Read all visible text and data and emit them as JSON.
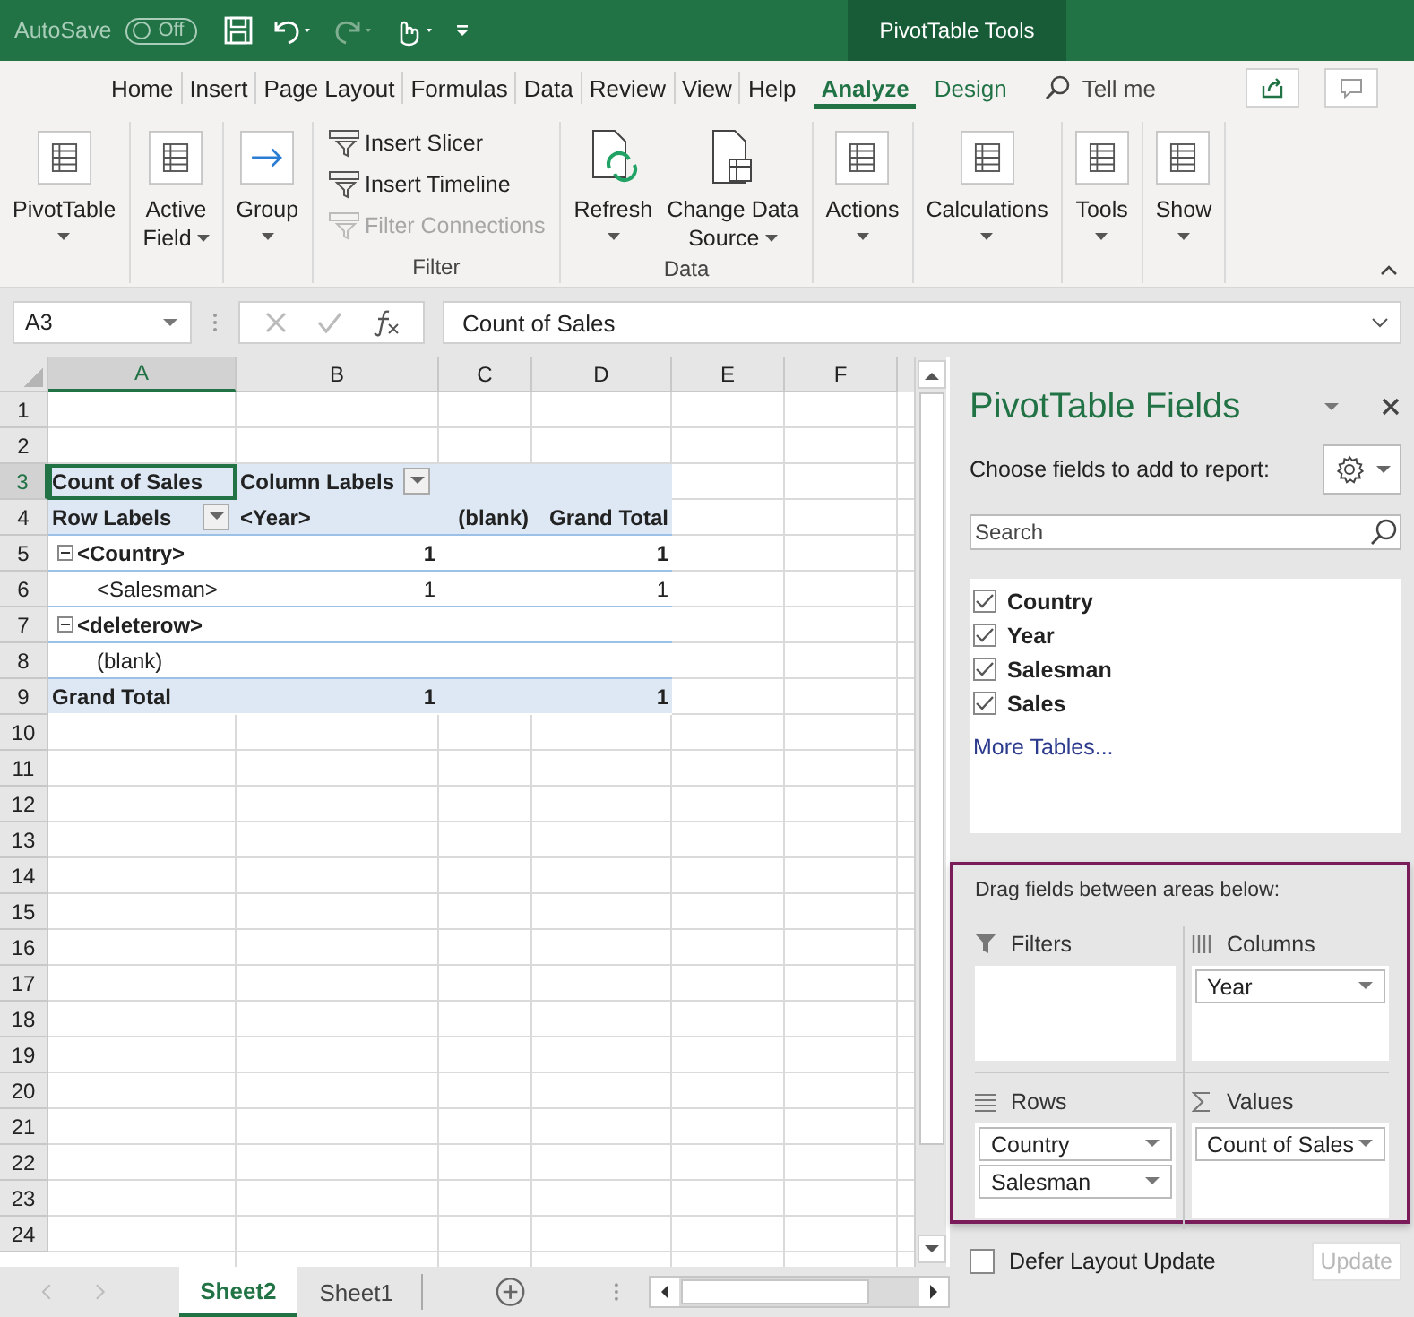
{
  "title_bar": {
    "autosave_label": "AutoSave",
    "autosave": {
      "on": false,
      "label": "Off"
    },
    "context_label": "PivotTable Tools"
  },
  "ribbon": {
    "tabs": [
      {
        "label": "Home",
        "selected": false,
        "contextual": false
      },
      {
        "label": "Insert",
        "selected": false,
        "contextual": false
      },
      {
        "label": "Page Layout",
        "selected": false,
        "contextual": false
      },
      {
        "label": "Formulas",
        "selected": false,
        "contextual": false
      },
      {
        "label": "Data",
        "selected": false,
        "contextual": false
      },
      {
        "label": "Review",
        "selected": false,
        "contextual": false
      },
      {
        "label": "View",
        "selected": false,
        "contextual": false
      },
      {
        "label": "Help",
        "selected": false,
        "contextual": false
      },
      {
        "label": "Analyze",
        "selected": true,
        "contextual": true
      },
      {
        "label": "Design",
        "selected": false,
        "contextual": true
      }
    ],
    "tell_me": "Tell me",
    "groups": [
      {
        "buttons": [
          {
            "kind": "large",
            "label": [
              "PivotTable"
            ],
            "dropdown": true
          }
        ]
      },
      {
        "buttons": [
          {
            "kind": "large",
            "label": [
              "Active",
              "Field"
            ],
            "dropdown": true
          }
        ]
      },
      {
        "buttons": [
          {
            "kind": "large",
            "label": [
              "Group"
            ],
            "dropdown": true
          }
        ]
      },
      {
        "label": "Filter",
        "buttons": [
          {
            "kind": "small",
            "label": [
              "Insert Slicer"
            ],
            "disabled": false
          },
          {
            "kind": "small",
            "label": [
              "Insert Timeline"
            ],
            "disabled": false
          },
          {
            "kind": "small",
            "label": [
              "Filter Connections"
            ],
            "disabled": true
          }
        ]
      },
      {
        "label": "Data",
        "buttons": [
          {
            "kind": "large",
            "label": [
              "Refresh"
            ],
            "dropdown": true
          },
          {
            "kind": "large",
            "label": [
              "Change Data",
              "Source"
            ],
            "dropdown": true
          }
        ]
      },
      {
        "buttons": [
          {
            "kind": "large",
            "label": [
              "Actions"
            ],
            "dropdown": true
          }
        ]
      },
      {
        "buttons": [
          {
            "kind": "large",
            "label": [
              "Calculations"
            ],
            "dropdown": true
          }
        ]
      },
      {
        "buttons": [
          {
            "kind": "large",
            "label": [
              "Tools"
            ],
            "dropdown": true
          }
        ]
      },
      {
        "buttons": [
          {
            "kind": "large",
            "label": [
              "Show"
            ],
            "dropdown": true
          }
        ]
      }
    ]
  },
  "formula_bar": {
    "name_box": "A3",
    "formula": "Count of Sales"
  },
  "sheet": {
    "columns": [
      {
        "label": "A",
        "selected": true
      },
      {
        "label": "B",
        "selected": false
      },
      {
        "label": "C",
        "selected": false
      },
      {
        "label": "D",
        "selected": false
      },
      {
        "label": "E",
        "selected": false
      },
      {
        "label": "F",
        "selected": false
      }
    ],
    "rows": [
      {
        "number": "1",
        "selected": false,
        "kind": "empty"
      },
      {
        "number": "2",
        "selected": false,
        "kind": "empty"
      },
      {
        "number": "3",
        "selected": true,
        "kind": "header",
        "cells": [
          {
            "text": "Count of Sales"
          },
          {
            "text": "Column Labels",
            "filter_button": true
          }
        ]
      },
      {
        "number": "4",
        "selected": false,
        "kind": "header-last",
        "cells": [
          {
            "text": "Row Labels",
            "filter_button": true
          },
          {
            "text": "<Year>"
          },
          {
            "text": "(blank)",
            "right_aligned": true
          },
          {
            "text": "Grand Total",
            "right_aligned": true
          }
        ]
      },
      {
        "number": "5",
        "selected": false,
        "kind": "group",
        "cells": [
          {
            "text": "<Country>",
            "expanded": true
          },
          {
            "text": "1",
            "right_aligned": true
          },
          {},
          {
            "text": "1",
            "right_aligned": true
          }
        ]
      },
      {
        "number": "6",
        "selected": false,
        "kind": "detail",
        "cells": [
          {
            "text": "<Salesman>"
          },
          {
            "text": "1",
            "right_aligned": true
          },
          {},
          {
            "text": "1",
            "right_aligned": true
          }
        ]
      },
      {
        "number": "7",
        "selected": false,
        "kind": "group",
        "cells": [
          {
            "text": "<deleterow>",
            "expanded": true
          }
        ]
      },
      {
        "number": "8",
        "selected": false,
        "kind": "detail",
        "cells": [
          {
            "text": "(blank)"
          }
        ]
      },
      {
        "number": "9",
        "selected": false,
        "kind": "total",
        "cells": [
          {
            "text": "Grand Total"
          },
          {
            "text": "1",
            "right_aligned": true
          },
          {},
          {
            "text": "1",
            "right_aligned": true
          }
        ]
      },
      {
        "number": "10",
        "selected": false,
        "kind": "empty"
      },
      {
        "number": "11",
        "selected": false,
        "kind": "empty"
      },
      {
        "number": "12",
        "selected": false,
        "kind": "empty"
      },
      {
        "number": "13",
        "selected": false,
        "kind": "empty"
      },
      {
        "number": "14",
        "selected": false,
        "kind": "empty"
      },
      {
        "number": "15",
        "selected": false,
        "kind": "empty"
      },
      {
        "number": "16",
        "selected": false,
        "kind": "empty"
      },
      {
        "number": "17",
        "selected": false,
        "kind": "empty"
      },
      {
        "number": "18",
        "selected": false,
        "kind": "empty"
      },
      {
        "number": "19",
        "selected": false,
        "kind": "empty"
      },
      {
        "number": "20",
        "selected": false,
        "kind": "empty"
      },
      {
        "number": "21",
        "selected": false,
        "kind": "empty"
      },
      {
        "number": "22",
        "selected": false,
        "kind": "empty"
      },
      {
        "number": "23",
        "selected": false,
        "kind": "empty"
      },
      {
        "number": "24",
        "selected": false,
        "kind": "empty"
      }
    ],
    "tabs": [
      {
        "label": "Sheet2",
        "selected": true
      },
      {
        "label": "Sheet1",
        "selected": false
      }
    ]
  },
  "pane": {
    "title": "PivotTable Fields",
    "subtitle": "Choose fields to add to report:",
    "search": {
      "placeholder": "Search"
    },
    "fields": [
      {
        "label": "Country",
        "checked": true
      },
      {
        "label": "Year",
        "checked": true
      },
      {
        "label": "Salesman",
        "checked": true
      },
      {
        "label": "Sales",
        "checked": true
      }
    ],
    "more_tables": "More Tables...",
    "areas_hint": "Drag fields between areas below:",
    "areas_highlighted": true,
    "areas": [
      {
        "kind": "filters",
        "label": "Filters"
      },
      {
        "kind": "columns",
        "label": "Columns",
        "fields": [
          "Year"
        ]
      },
      {
        "kind": "rows",
        "label": "Rows",
        "fields": [
          "Country",
          "Salesman"
        ]
      },
      {
        "kind": "values",
        "label": "Values",
        "fields": [
          "Count of Sales"
        ]
      }
    ],
    "defer": {
      "label": "Defer Layout Update",
      "checked": false
    },
    "update": {
      "label": "Update",
      "disabled": true
    }
  }
}
